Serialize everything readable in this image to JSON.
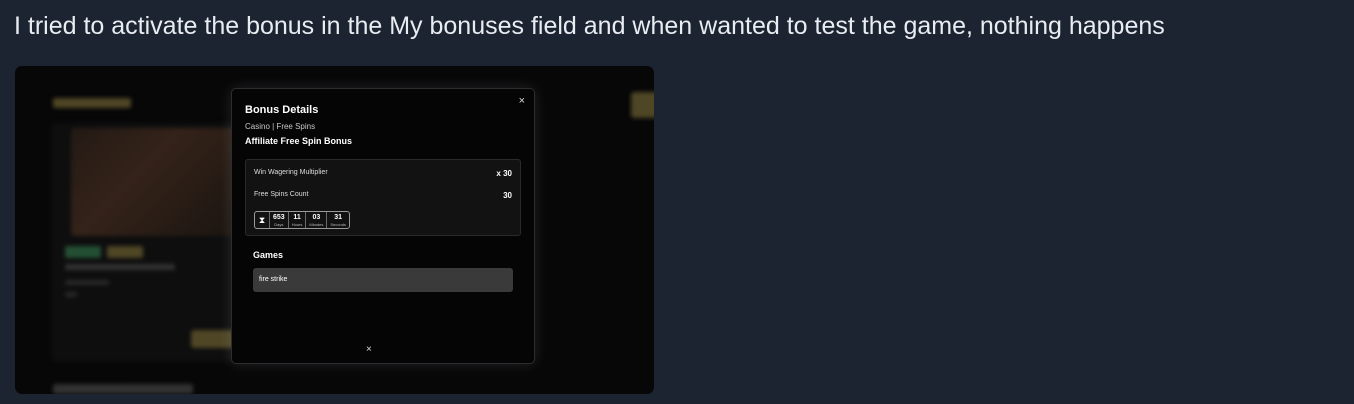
{
  "message": {
    "text": "I tried to activate the bonus in the My bonuses field and when wanted to test the game, nothing happens"
  },
  "modal": {
    "title": "Bonus Details",
    "subtitle": "Casino | Free Spins",
    "bonus_name": "Affiliate Free Spin Bonus",
    "close_icon": "×",
    "details": [
      {
        "label": "Win Wagering Multiplier",
        "value": "x 30"
      },
      {
        "label": "Free Spins Count",
        "value": "30"
      }
    ],
    "timer": {
      "icon": "hourglass-icon",
      "days": "653",
      "days_label": "Days",
      "hours": "11",
      "hours_label": "Hours",
      "minutes": "03",
      "minutes_label": "Minutes",
      "seconds": "31",
      "seconds_label": "Seconds"
    },
    "games_title": "Games",
    "games": [
      "fire strike"
    ],
    "close_bottom": "×"
  },
  "colors": {
    "chat_background": "#1b2430",
    "modal_background": "#050505",
    "accent_gold": "#8a7a3e"
  }
}
